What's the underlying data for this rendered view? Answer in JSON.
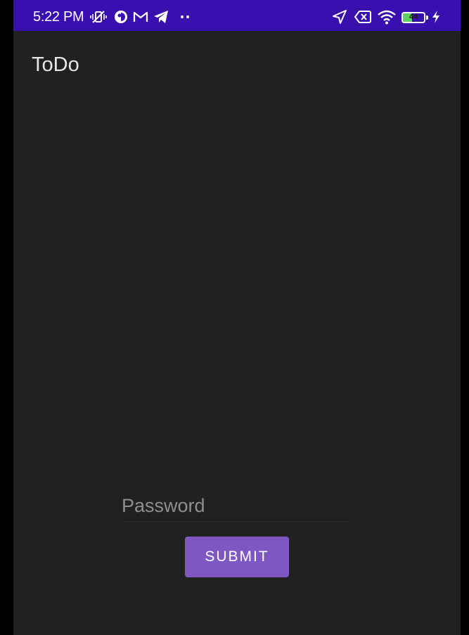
{
  "status_bar": {
    "time": "5:22 PM",
    "battery_level": "44",
    "battery_percent": 44,
    "background_color": "#3a0fb0",
    "icons": [
      "vibrate-off-icon",
      "app-notification-icon",
      "gmail-icon",
      "telegram-icon",
      "more-notifications-icon",
      "location-icon",
      "no-sim-icon",
      "wifi-icon",
      "battery-icon",
      "charging-icon"
    ]
  },
  "app": {
    "title": "ToDo",
    "background_color": "#212121"
  },
  "form": {
    "password_placeholder": "Password",
    "password_value": "",
    "submit_label": "SUBMIT",
    "accent_color": "#7e57c2"
  }
}
